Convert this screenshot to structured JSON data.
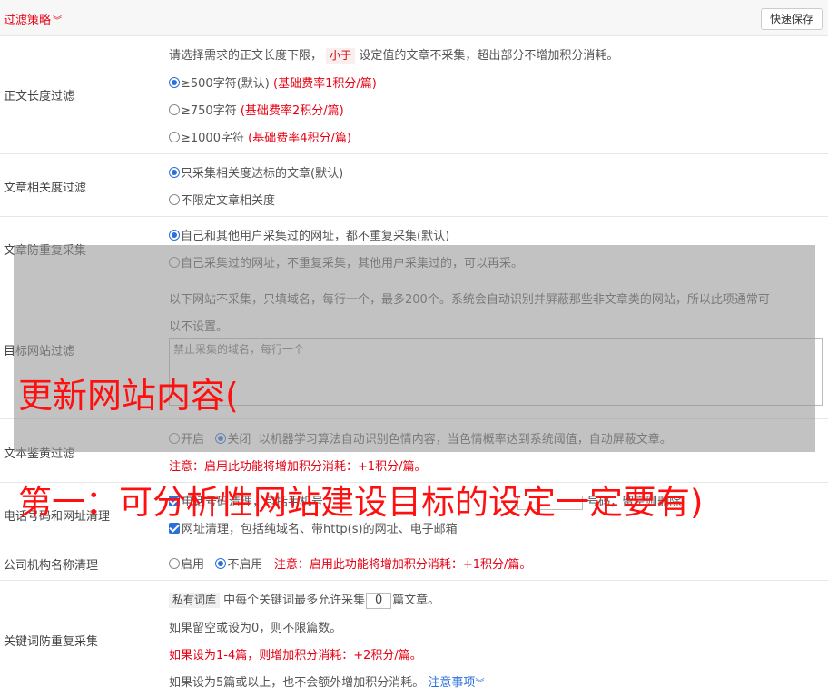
{
  "header": {
    "title": "过滤策略",
    "chevron": "chevron-down-icon",
    "save_label": "快速保存"
  },
  "length_filter": {
    "label": "正文长度过滤",
    "desc_prefix": "请选择需求的正文长度下限，",
    "desc_tag": "小于",
    "desc_suffix": "设定值的文章不采集，超出部分不增加积分消耗。",
    "options": [
      {
        "label": "≥500字符(默认)",
        "note": "(基础费率1积分/篇)",
        "selected": true
      },
      {
        "label": "≥750字符",
        "note": "(基础费率2积分/篇)",
        "selected": false
      },
      {
        "label": "≥1000字符",
        "note": "(基础费率4积分/篇)",
        "selected": false
      }
    ]
  },
  "relevance": {
    "label": "文章相关度过滤",
    "options": [
      {
        "label": "只采集相关度达标的文章(默认)",
        "selected": true
      },
      {
        "label": "不限定文章相关度",
        "selected": false
      }
    ]
  },
  "dedup": {
    "label": "文章防重复采集",
    "options": [
      {
        "label": "自己和其他用户采集过的网址，都不重复采集(默认)",
        "selected": true
      },
      {
        "label": "自己采集过的网址，不重复采集，其他用户采集过的，可以再采。",
        "selected": false
      }
    ]
  },
  "site_filter": {
    "label": "目标网站过滤",
    "desc_line1": "以下网站不采集，只填域名，每行一个，最多200个。系统会自动识别并屏蔽那些非文章类的网站，所以此项通常可",
    "desc_line2": "以不设置。",
    "placeholder": "禁止采集的域名，每行一个"
  },
  "porn_filter": {
    "label": "文本鉴黄过滤",
    "on_label": "开启",
    "off_label": "关闭",
    "off_selected": true,
    "desc": "以机器学习算法自动识别色情内容，当色情概率达到系统阈值，自动屏蔽文章。",
    "note": "注意：启用此功能将增加积分消耗：+1积分/篇。"
  },
  "phone_url": {
    "label": "电话号码和网址清理",
    "line1_left": "电话号码清理，包括手机号",
    "line1_right": "号码，留空则删除",
    "line2": "网址清理，包括纯域名、带http(s)的网址、电子邮箱"
  },
  "company": {
    "label": "公司机构名称清理",
    "on_label": "启用",
    "off_label": "不启用",
    "off_selected": true,
    "note": "注意：启用此功能将增加积分消耗：+1积分/篇。"
  },
  "keyword_dedup": {
    "label": "关键词防重复采集",
    "tag": "私有词库",
    "text_before": "中每个关键词最多允许采集",
    "value": "0",
    "text_after": "篇文章。",
    "line2": "如果留空或设为0，则不限篇数。",
    "line3": "如果设为1-4篇，则增加积分消耗：+2积分/篇。",
    "line4": "如果设为5篇或以上，也不会额外增加积分消耗。",
    "link": "注意事项"
  },
  "overlay_text": {
    "line1": "更新网站内容(",
    "line2": "第一：可分析性网站建设目标的设定一定要有)"
  }
}
